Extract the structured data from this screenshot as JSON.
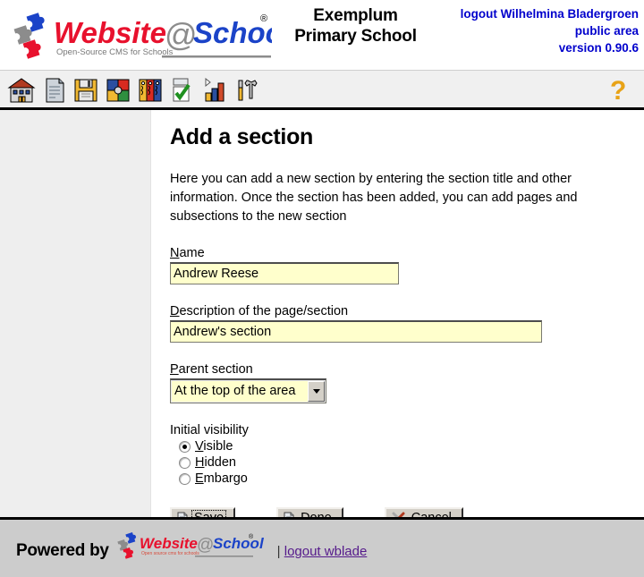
{
  "header": {
    "logo": {
      "alt": "Website@School",
      "word_1": "Website",
      "word_at": "@",
      "word_2": "School",
      "registered": "®",
      "tagline": "Open-Source CMS for Schools",
      "color_red": "#e8112d",
      "color_blue": "#1b43c8",
      "color_gray": "#8c8c8c"
    },
    "school_name_line1": "Exemplum",
    "school_name_line2": "Primary School",
    "logout_user": "logout Wilhelmina Bladergroen",
    "area": "public area",
    "version": "version 0.90.6",
    "right_color": "#0000cc"
  },
  "toolbar": {
    "items": [
      {
        "name": "school-icon",
        "title": "School"
      },
      {
        "name": "pages-icon",
        "title": "Pages"
      },
      {
        "name": "save-disk-icon",
        "title": "Save"
      },
      {
        "name": "modules-icon",
        "title": "Modules"
      },
      {
        "name": "users-icon",
        "title": "Users"
      },
      {
        "name": "checklist-icon",
        "title": "Checklist"
      },
      {
        "name": "statistics-icon",
        "title": "Statistics"
      },
      {
        "name": "tools-icon",
        "title": "Tools"
      }
    ],
    "help_label": "?"
  },
  "main": {
    "title": "Add a section",
    "intro": "Here you can add a new section by entering the section title and other information. Once the section has been added, you can add pages and subsections to the new section",
    "name_field": {
      "label_accel": "N",
      "label_rest": "ame",
      "value": "Andrew Reese"
    },
    "description_field": {
      "label_accel": "D",
      "label_rest": "escription of the page/section",
      "value": "Andrew's section"
    },
    "parent_field": {
      "label_accel": "P",
      "label_rest": "arent section",
      "value": "At the top of the area",
      "options": [
        "At the top of the area"
      ]
    },
    "visibility": {
      "title": "Initial visibility",
      "options": [
        {
          "accel": "V",
          "rest": "isible",
          "selected": true
        },
        {
          "accel": "H",
          "rest": "idden",
          "selected": false
        },
        {
          "accel": "E",
          "rest": "mbargo",
          "selected": false
        }
      ]
    },
    "buttons": [
      {
        "label": "Save",
        "icon": "document-icon",
        "focused": true
      },
      {
        "label": "Done",
        "icon": "document-icon",
        "focused": false
      },
      {
        "label": "Cancel",
        "icon": "cancel-cross-icon",
        "focused": false
      }
    ]
  },
  "footer": {
    "powered_by": "Powered by",
    "logo_word_1": "Website",
    "logo_word_at": "@",
    "logo_word_2": "School",
    "logo_registered": "®",
    "logo_tagline": "Open source cms for schools",
    "separator": "|",
    "logout_link": "logout wblade",
    "link_color": "#551a8b",
    "background": "#cccccc"
  }
}
